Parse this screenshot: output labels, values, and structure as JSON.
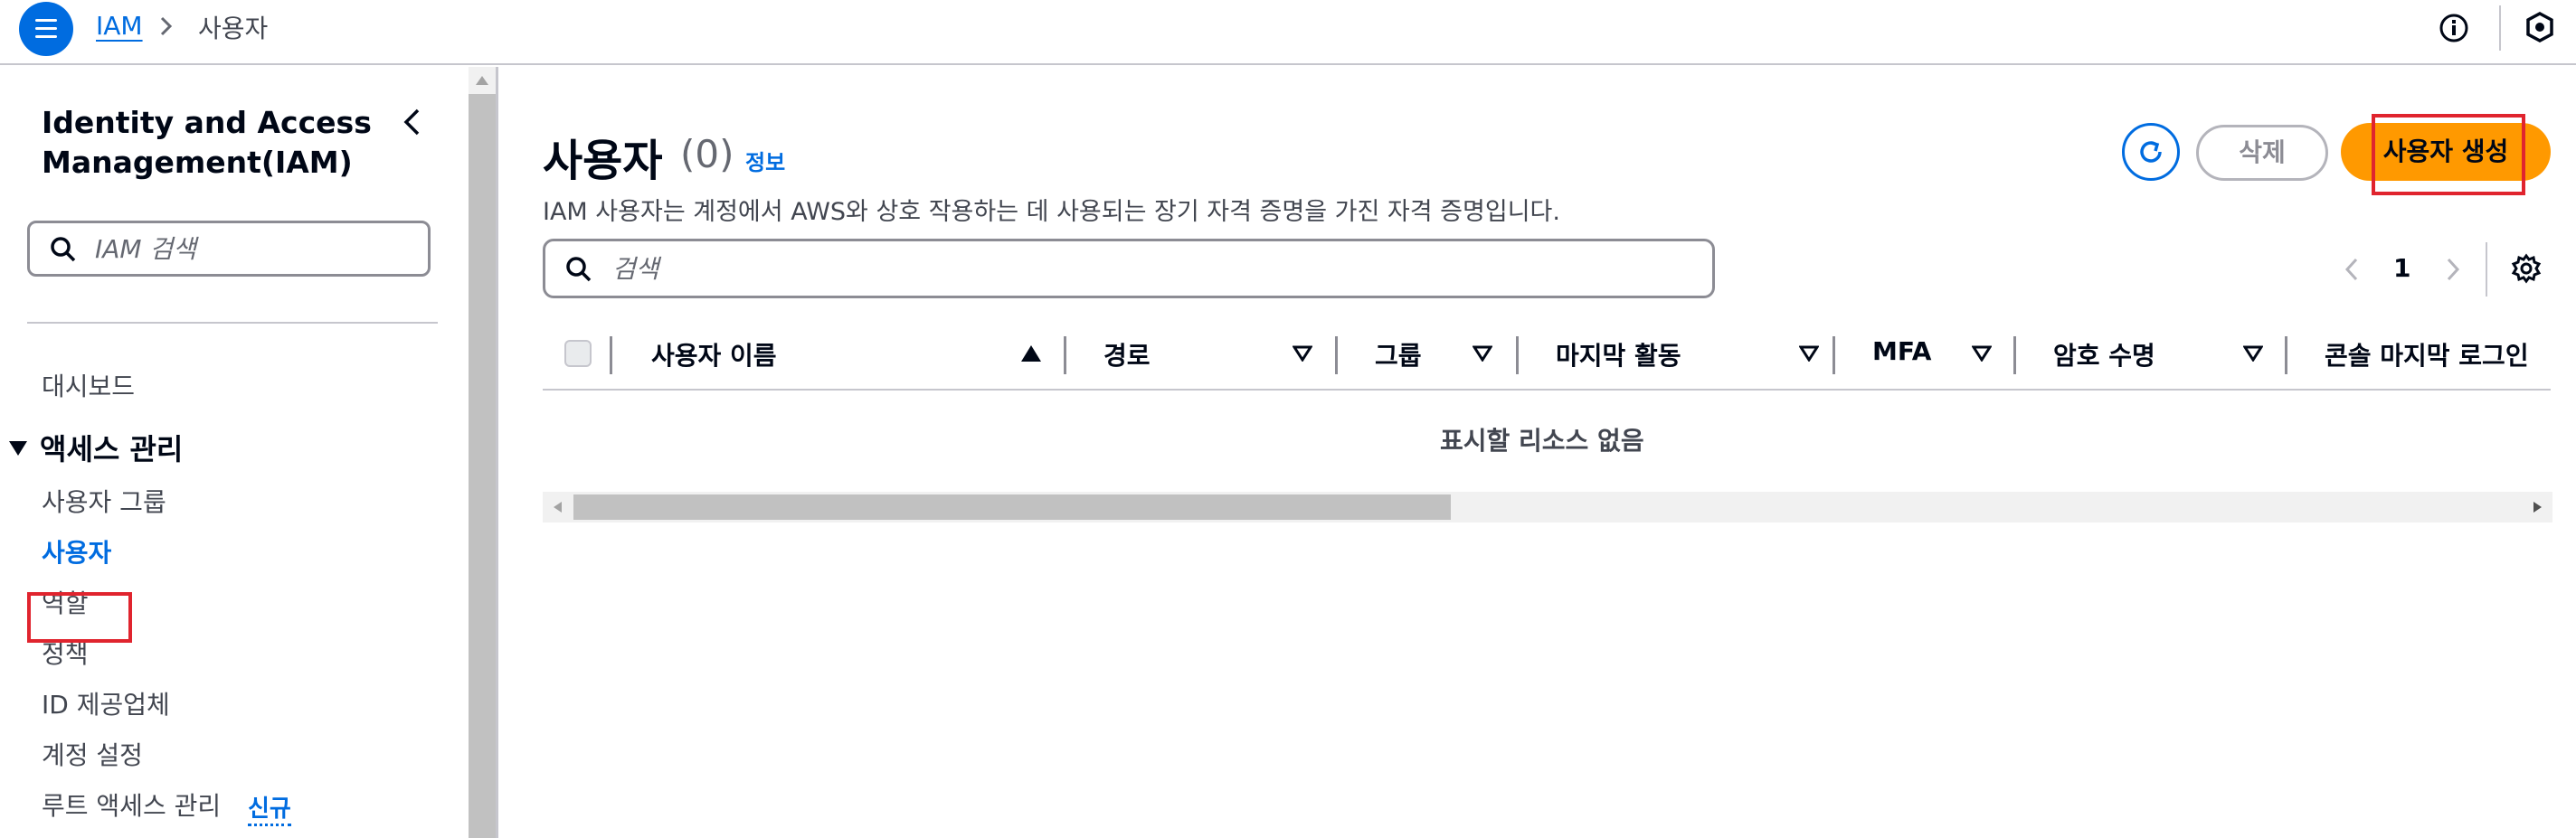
{
  "colors": {
    "primary": "#006ce0",
    "accent_orange": "#ff9900",
    "highlight_red": "#e0242e",
    "text_dark": "#000716",
    "text_muted": "#424650"
  },
  "topbar": {
    "menu_icon": "hamburger-menu-icon",
    "breadcrumb": {
      "root": "IAM",
      "separator_icon": "chevron-right-icon",
      "current": "사용자"
    },
    "info_icon": "info-icon",
    "shield_icon": "shield-settings-icon"
  },
  "sidenav": {
    "title": "Identity and Access Management(IAM)",
    "collapse_icon": "chevron-left-icon",
    "search_placeholder": "IAM 검색",
    "dashboard": "대시보드",
    "section_label": "액세스 관리",
    "items": [
      {
        "label": "사용자 그룹"
      },
      {
        "label": "사용자"
      },
      {
        "label": "역할"
      },
      {
        "label": "정책"
      },
      {
        "label": "ID 제공업체"
      },
      {
        "label": "계정 설정"
      },
      {
        "label": "루트 액세스 관리"
      }
    ],
    "active_item": "사용자",
    "new_badge": "신규"
  },
  "main": {
    "title": "사용자",
    "count": "(0)",
    "info_link": "정보",
    "description": "IAM 사용자는 계정에서 AWS와 상호 작용하는 데 사용되는 장기 자격 증명을 가진 자격 증명입니다.",
    "refresh_icon": "refresh-icon",
    "delete_label": "삭제",
    "create_label": "사용자 생성",
    "search_placeholder": "검색",
    "pager": {
      "current_page": "1",
      "prev_icon": "chevron-left-icon",
      "next_icon": "chevron-right-icon"
    },
    "settings_icon": "gear-icon",
    "table": {
      "columns": [
        {
          "label": "사용자 이름",
          "sort": "ascending"
        },
        {
          "label": "경로",
          "sort": "none"
        },
        {
          "label": "그룹",
          "sort": "none"
        },
        {
          "label": "마지막 활동",
          "sort": "none"
        },
        {
          "label": "MFA",
          "sort": "none"
        },
        {
          "label": "암호 수명",
          "sort": "none"
        },
        {
          "label": "콘솔 마지막 로그인",
          "sort": "none"
        }
      ],
      "empty_message": "표시할 리소스 없음"
    }
  }
}
